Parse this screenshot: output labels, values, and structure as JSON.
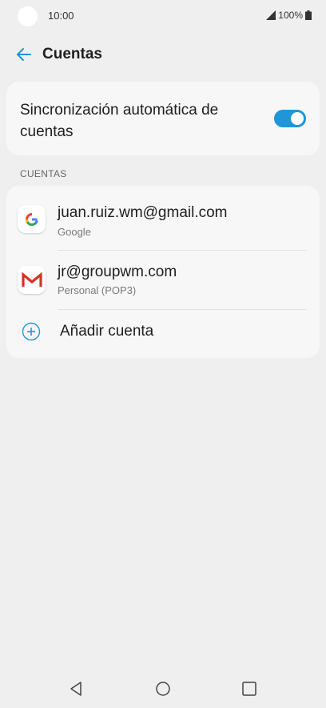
{
  "status_bar": {
    "time": "10:00",
    "battery": "100%",
    "icons": [
      "signal-icon",
      "battery-icon"
    ]
  },
  "app_bar": {
    "title": "Cuentas",
    "back_icon": "arrow-left-icon"
  },
  "sync": {
    "label": "Sincronización automática de cuentas",
    "enabled": true
  },
  "accounts_section": {
    "header": "CUENTAS",
    "accounts": [
      {
        "email": "juan.ruiz.wm@gmail.com",
        "type": "Google",
        "icon": "google-icon"
      },
      {
        "email": "jr@groupwm.com",
        "type": "Personal (POP3)",
        "icon": "gmail-icon"
      }
    ],
    "add_label": "Añadir cuenta"
  },
  "colors": {
    "accent": "#1e96d8",
    "background": "#efefef",
    "card": "#f7f7f7"
  },
  "nav_bar": {
    "icons": [
      "back-nav-icon",
      "home-nav-icon",
      "recents-nav-icon"
    ]
  }
}
